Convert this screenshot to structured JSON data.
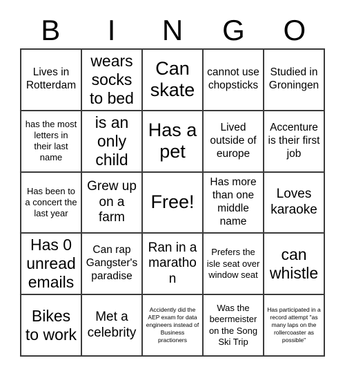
{
  "header": {
    "letters": [
      "B",
      "I",
      "N",
      "G",
      "O"
    ]
  },
  "grid": {
    "rows": [
      [
        {
          "text": "Lives in Rotterdam",
          "size": "fs-md"
        },
        {
          "text": "wears socks to bed",
          "size": "fs-xl"
        },
        {
          "text": "Can skate",
          "size": "fs-xxl"
        },
        {
          "text": "cannot use chopsticks",
          "size": "fs-md"
        },
        {
          "text": "Studied in Groningen",
          "size": "fs-md"
        }
      ],
      [
        {
          "text": "has the most letters in their last name",
          "size": "fs-sm"
        },
        {
          "text": "is an only child",
          "size": "fs-xl"
        },
        {
          "text": "Has a pet",
          "size": "fs-xxl"
        },
        {
          "text": "Lived outside of europe",
          "size": "fs-md"
        },
        {
          "text": "Accenture is their first job",
          "size": "fs-md"
        }
      ],
      [
        {
          "text": "Has been to a concert the last year",
          "size": "fs-sm"
        },
        {
          "text": "Grew up on a farm",
          "size": "fs-lg"
        },
        {
          "text": "Free!",
          "size": "fs-xxl"
        },
        {
          "text": "Has more than one middle name",
          "size": "fs-md"
        },
        {
          "text": "Loves karaoke",
          "size": "fs-lg"
        }
      ],
      [
        {
          "text": "Has 0 unread emails",
          "size": "fs-xl"
        },
        {
          "text": "Can rap Gangster's paradise",
          "size": "fs-md"
        },
        {
          "text": "Ran in a marathon",
          "size": "fs-lg"
        },
        {
          "text": "Prefers the isle seat over window seat",
          "size": "fs-sm"
        },
        {
          "text": "can whistle",
          "size": "fs-xl"
        }
      ],
      [
        {
          "text": "Bikes to work",
          "size": "fs-xl"
        },
        {
          "text": "Met a celebrity",
          "size": "fs-lg"
        },
        {
          "text": "Accidently did the AEP exam for data engineers instead of Business practioners",
          "size": "fs-xs"
        },
        {
          "text": "Was the beermeister on the Song Ski Trip",
          "size": "fs-sm"
        },
        {
          "text": "Has participated in a record attempt \"as many laps on the rollercoaster as possible\"",
          "size": "fs-xs"
        }
      ]
    ]
  },
  "colors": {
    "background": "#ffffff",
    "text": "#000000",
    "grid_line": "#3a3a3a"
  }
}
